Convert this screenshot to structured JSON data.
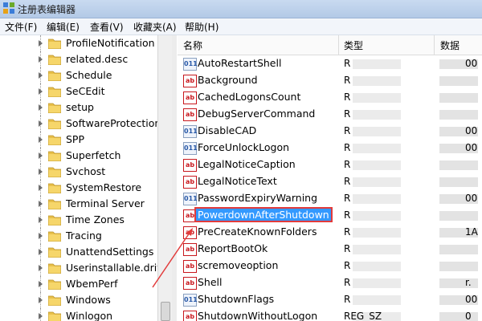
{
  "window": {
    "title": "注册表编辑器"
  },
  "menu": [
    "文件(F)",
    "编辑(E)",
    "查看(V)",
    "收藏夹(A)",
    "帮助(H)"
  ],
  "tree": {
    "items": [
      "ProfileNotification",
      "related.desc",
      "Schedule",
      "SeCEdit",
      "setup",
      "SoftwareProtectionP",
      "SPP",
      "Superfetch",
      "Svchost",
      "SystemRestore",
      "Terminal Server",
      "Time Zones",
      "Tracing",
      "UnattendSettings",
      "Userinstallable.drive",
      "WbemPerf",
      "Windows",
      "Winlogon"
    ]
  },
  "list": {
    "headers": {
      "name": "名称",
      "type": "类型",
      "data": "数据"
    },
    "rows": [
      {
        "name": "AutoRestartShell",
        "icon": "dword",
        "type": "R",
        "data": "00"
      },
      {
        "name": "Background",
        "icon": "string",
        "type": "R",
        "data": ""
      },
      {
        "name": "CachedLogonsCount",
        "icon": "string",
        "type": "R",
        "data": ""
      },
      {
        "name": "DebugServerCommand",
        "icon": "string",
        "type": "R",
        "data": ""
      },
      {
        "name": "DisableCAD",
        "icon": "dword",
        "type": "R",
        "data": "00"
      },
      {
        "name": "ForceUnlockLogon",
        "icon": "dword",
        "type": "R",
        "data": "00"
      },
      {
        "name": "LegalNoticeCaption",
        "icon": "string",
        "type": "R",
        "data": ""
      },
      {
        "name": "LegalNoticeText",
        "icon": "string",
        "type": "R",
        "data": ""
      },
      {
        "name": "PasswordExpiryWarning",
        "icon": "dword",
        "type": "R",
        "data": "00"
      },
      {
        "name": "PowerdownAfterShutdown",
        "icon": "string",
        "type": "R",
        "data": ""
      },
      {
        "name": "PreCreateKnownFolders",
        "icon": "string",
        "type": "R",
        "data": "1A"
      },
      {
        "name": "ReportBootOk",
        "icon": "string",
        "type": "R",
        "data": ""
      },
      {
        "name": "scremoveoption",
        "icon": "string",
        "type": "R",
        "data": ""
      },
      {
        "name": "Shell",
        "icon": "string",
        "type": "R",
        "data": "r."
      },
      {
        "name": "ShutdownFlags",
        "icon": "dword",
        "type": "R",
        "data": "00"
      },
      {
        "name": "ShutdownWithoutLogon",
        "icon": "string",
        "type": "REG_SZ",
        "data": "0"
      }
    ]
  },
  "selected_row": "PowerdownAfterShutdown",
  "colors": {
    "selection": "#3399ff",
    "annotation": "#e23b3b"
  }
}
